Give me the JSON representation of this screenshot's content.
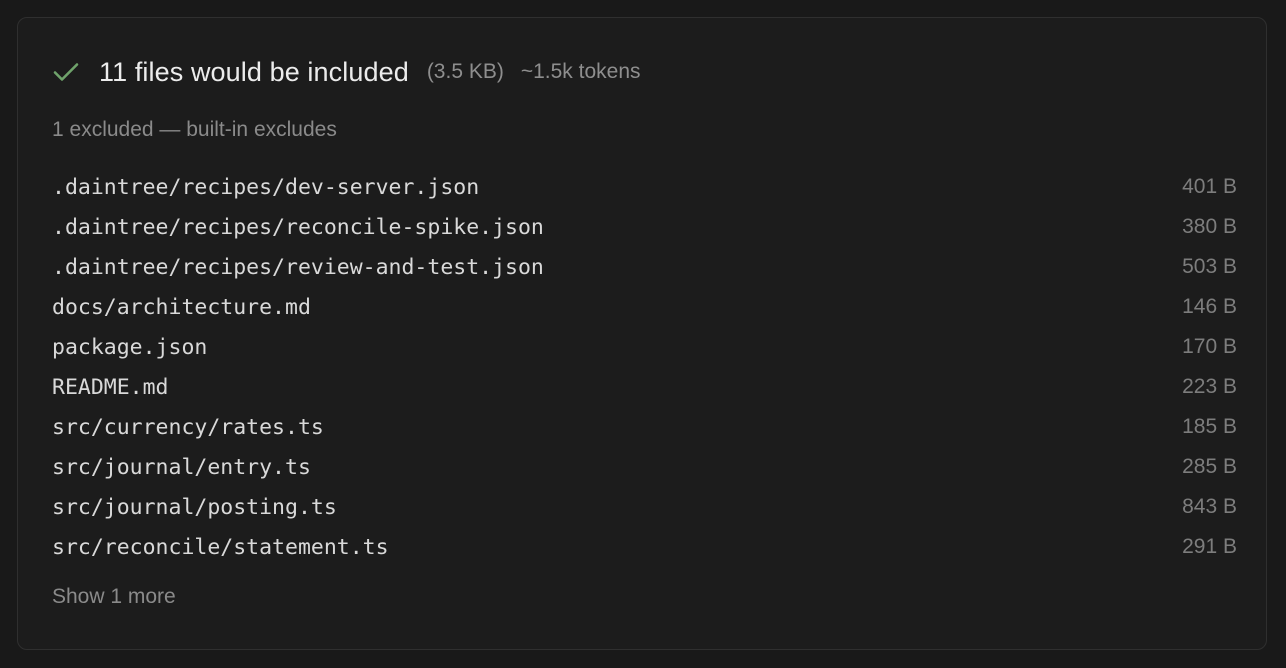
{
  "summary": {
    "icon": "check-icon",
    "title": "11 files would be included",
    "size": "(3.5 KB)",
    "tokens": "~1.5k tokens",
    "check_color": "#6fa36b"
  },
  "excluded_text": "1 excluded — built-in excludes",
  "files": [
    {
      "path": ".daintree/recipes/dev-server.json",
      "size": "401 B"
    },
    {
      "path": ".daintree/recipes/reconcile-spike.json",
      "size": "380 B"
    },
    {
      "path": ".daintree/recipes/review-and-test.json",
      "size": "503 B"
    },
    {
      "path": "docs/architecture.md",
      "size": "146 B"
    },
    {
      "path": "package.json",
      "size": "170 B"
    },
    {
      "path": "README.md",
      "size": "223 B"
    },
    {
      "path": "src/currency/rates.ts",
      "size": "185 B"
    },
    {
      "path": "src/journal/entry.ts",
      "size": "285 B"
    },
    {
      "path": "src/journal/posting.ts",
      "size": "843 B"
    },
    {
      "path": "src/reconcile/statement.ts",
      "size": "291 B"
    }
  ],
  "show_more_label": "Show 1 more"
}
